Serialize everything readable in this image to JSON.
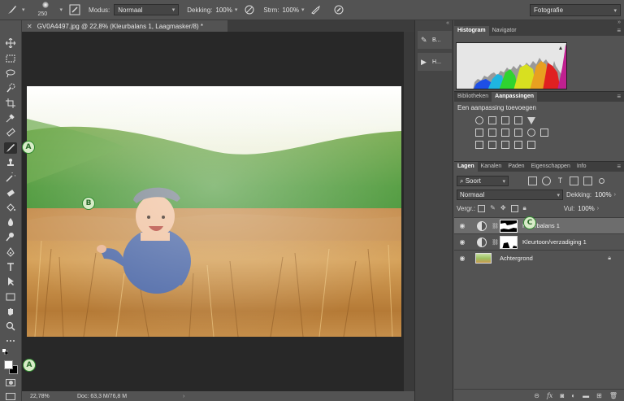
{
  "options_bar": {
    "brush_size": "250",
    "mode_label": "Modus:",
    "mode_value": "Normaal",
    "opacity_label": "Dekking:",
    "opacity_value": "100%",
    "flow_label": "Strm:",
    "flow_value": "100%",
    "workspace": "Fotografie"
  },
  "document": {
    "tab_title": "GV0A4497.jpg @ 22,8% (Kleurbalans 1, Laagmasker/8) *",
    "status_zoom": "22,78%",
    "status_doc": "Doc: 63,3 M/76,8 M"
  },
  "dock": {
    "item1": "B...",
    "item2": "H..."
  },
  "panels": {
    "histogram_tab": "Histogram",
    "navigator_tab": "Navigator",
    "libraries_tab": "Bibliotheken",
    "adjustments_tab": "Aanpassingen",
    "adjustments_title": "Een aanpassing toevoegen",
    "layers_tabs": [
      "Lagen",
      "Kanalen",
      "Paden",
      "Eigenschappen",
      "Info"
    ],
    "filter_kind": "Soort",
    "blend_mode": "Normaal",
    "opacity_label": "Dekking:",
    "opacity_value": "100%",
    "lock_label": "Vergr.:",
    "fill_label": "Vul:",
    "fill_value": "100%",
    "layers": [
      {
        "name": "Kleurbalans 1",
        "selected": true
      },
      {
        "name": "Kleurtoon/verzadiging 1",
        "selected": false
      },
      {
        "name": "Achtergrond",
        "selected": false
      }
    ]
  },
  "annotations": {
    "a_top": "A",
    "b": "B",
    "c": "C",
    "a_bottom": "A"
  },
  "colors": {
    "ui_bg": "#535353",
    "canvas_bg": "#282828",
    "badge_green": "#2e8a2e"
  }
}
